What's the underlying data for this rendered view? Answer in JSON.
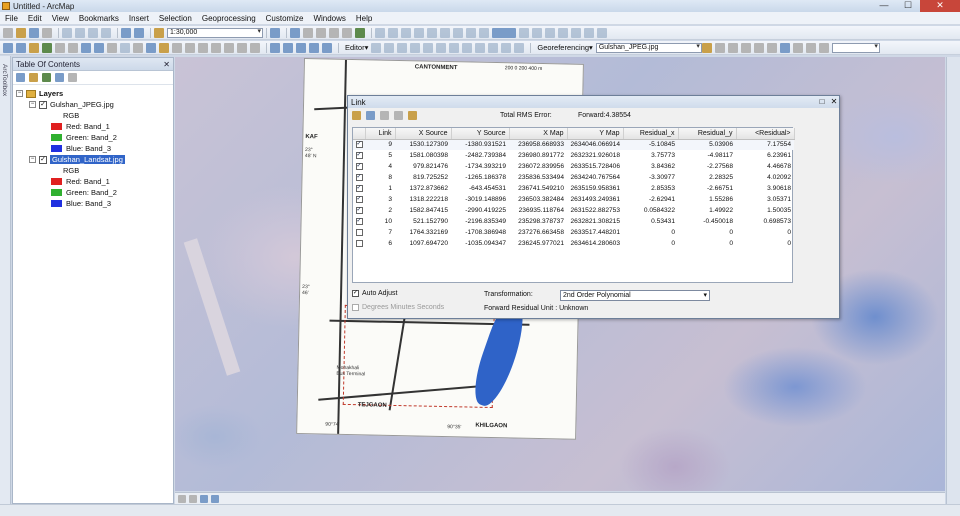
{
  "window": {
    "title": "Untitled - ArcMap",
    "minimize": "—",
    "maximize": "☐",
    "close": "✕"
  },
  "menu": [
    "File",
    "Edit",
    "View",
    "Bookmarks",
    "Insert",
    "Selection",
    "Geoprocessing",
    "Customize",
    "Windows",
    "Help"
  ],
  "toolbar": {
    "scale": "1:30,000",
    "editor_label": "Editor▾",
    "georef_label": "Georeferencing▾",
    "georef_layer": "Gulshan_JPEG.jpg"
  },
  "arctoolbox_label": "ArcToolbox",
  "toc": {
    "title": "Table Of Contents",
    "pin": "✕",
    "root_label": "Layers",
    "layers": [
      {
        "name": "Gulshan_JPEG.jpg",
        "checked": "✓",
        "type_label": "RGB",
        "bands": [
          {
            "label": "Red:  Band_1",
            "color": "#e02020"
          },
          {
            "label": "Green: Band_2",
            "color": "#30b030"
          },
          {
            "label": "Blue:  Band_3",
            "color": "#2030e0"
          }
        ]
      },
      {
        "name": "Gulshan_Landsat.jpg",
        "checked": "✓",
        "type_label": "RGB",
        "bands": [
          {
            "label": "Red:  Band_1",
            "color": "#e02020"
          },
          {
            "label": "Green: Band_2",
            "color": "#30b030"
          },
          {
            "label": "Blue:  Band_3",
            "color": "#2030e0"
          }
        ]
      }
    ]
  },
  "paper_map": {
    "labels": {
      "cantonment": "CANTONMENT",
      "tejgaon": "TEJGAON",
      "khilgaon": "KHILGAON",
      "kaf": "KAF",
      "lat1": "23°\n48' N",
      "lat2": "23°\n46'",
      "lon1": "90°74'",
      "lon2": "90°35'",
      "bus_terminal": "Mohakhali\nBus Terminal",
      "scale": "200  0   200  400 m"
    }
  },
  "link": {
    "title": "Link",
    "rms_label": "Total RMS Error:",
    "rms_value": "Forward:4.38554",
    "columns": [
      "",
      "Link",
      "X Source",
      "Y Source",
      "X Map",
      "Y Map",
      "Residual_x",
      "Residual_y",
      "<Residual>"
    ],
    "rows": [
      {
        "checked": "✓",
        "link": "9",
        "xs": "1530.127309",
        "ys": "-1380.931521",
        "xm": "236958.668933",
        "ym": "2634046.066914",
        "rx": "-5.10845",
        "ry": "5.03906",
        "r": "7.17554"
      },
      {
        "checked": "✓",
        "link": "5",
        "xs": "1581.080398",
        "ys": "-2482.739384",
        "xm": "236980.891772",
        "ym": "2632321.926018",
        "rx": "3.75773",
        "ry": "-4.98117",
        "r": "6.23961"
      },
      {
        "checked": "✓",
        "link": "4",
        "xs": "979.821476",
        "ys": "-1734.393219",
        "xm": "236072.839956",
        "ym": "2633515.728406",
        "rx": "3.84362",
        "ry": "-2.27568",
        "r": "4.46678"
      },
      {
        "checked": "✓",
        "link": "8",
        "xs": "819.725252",
        "ys": "-1265.186378",
        "xm": "235836.533494",
        "ym": "2634240.767564",
        "rx": "-3.30977",
        "ry": "2.28325",
        "r": "4.02092"
      },
      {
        "checked": "✓",
        "link": "1",
        "xs": "1372.873662",
        "ys": "-643.454531",
        "xm": "236741.549210",
        "ym": "2635159.958361",
        "rx": "2.85353",
        "ry": "-2.66751",
        "r": "3.90618"
      },
      {
        "checked": "✓",
        "link": "3",
        "xs": "1318.222218",
        "ys": "-3019.148896",
        "xm": "236503.382484",
        "ym": "2631493.249361",
        "rx": "-2.62941",
        "ry": "1.55286",
        "r": "3.05371"
      },
      {
        "checked": "✓",
        "link": "2",
        "xs": "1582.847415",
        "ys": "-2990.419225",
        "xm": "236935.118764",
        "ym": "2631522.882753",
        "rx": "0.0584322",
        "ry": "1.49922",
        "r": "1.50035"
      },
      {
        "checked": "✓",
        "link": "10",
        "xs": "521.152790",
        "ys": "-2196.835349",
        "xm": "235298.378737",
        "ym": "2632821.308215",
        "rx": "0.53431",
        "ry": "-0.450018",
        "r": "0.698573"
      },
      {
        "checked": "",
        "link": "7",
        "xs": "1764.332169",
        "ys": "-1708.386948",
        "xm": "237276.663458",
        "ym": "2633517.448201",
        "rx": "0",
        "ry": "0",
        "r": "0"
      },
      {
        "checked": "",
        "link": "6",
        "xs": "1097.694720",
        "ys": "-1035.094347",
        "xm": "236245.977021",
        "ym": "2634614.280603",
        "rx": "0",
        "ry": "0",
        "r": "0"
      }
    ],
    "auto_adjust_label": "Auto Adjust",
    "auto_adjust_checked": "✓",
    "dms_label": "Degrees Minutes Seconds",
    "transformation_label": "Transformation:",
    "transformation_value": "2nd Order Polynomial",
    "forward_unit": "Forward Residual Unit : Unknown"
  }
}
